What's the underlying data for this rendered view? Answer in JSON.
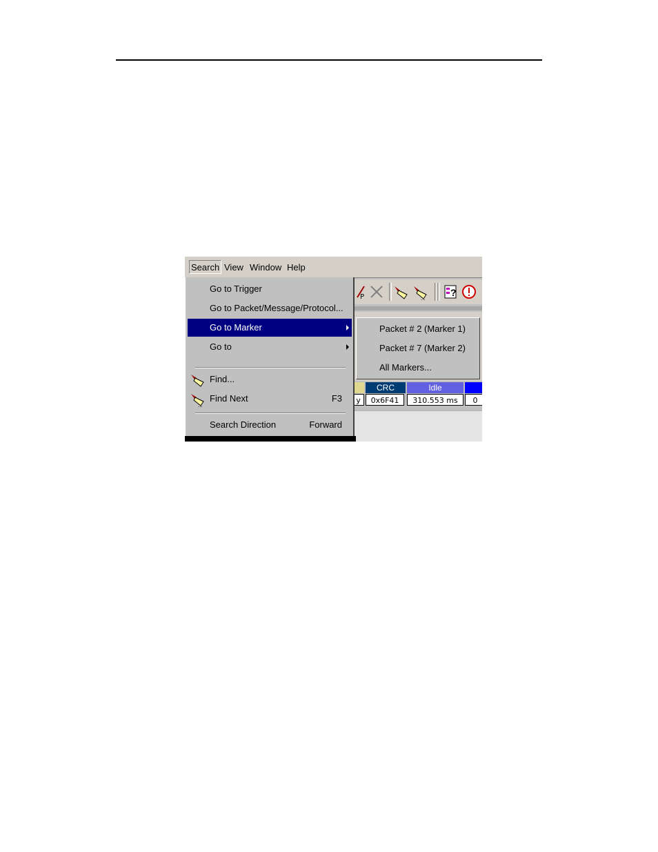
{
  "menubar": {
    "items": [
      {
        "label": "Search",
        "active": true
      },
      {
        "label": "View"
      },
      {
        "label": "Window"
      },
      {
        "label": "Help"
      }
    ]
  },
  "search_menu": {
    "items": [
      {
        "label": "Go to Trigger"
      },
      {
        "label": "Go to Packet/Message/Protocol..."
      },
      {
        "label": "Go to Marker",
        "highlighted": true,
        "submenu": true
      },
      {
        "label": "Go to",
        "submenu": true
      },
      {
        "label": "Find...",
        "icon": "flashlight-find-icon"
      },
      {
        "label": "Find Next",
        "shortcut": "F3",
        "icon": "flashlight-find-next-icon"
      },
      {
        "label": "Search Direction",
        "value": "Forward"
      }
    ]
  },
  "marker_submenu": {
    "items": [
      {
        "label": "Packet # 2 (Marker 1)"
      },
      {
        "label": "Packet # 7 (Marker 2)"
      },
      {
        "label": "All Markers..."
      }
    ]
  },
  "trace": {
    "headers": [
      {
        "label": "",
        "color": "#e0d890"
      },
      {
        "label": "CRC",
        "color": "#003c74"
      },
      {
        "label": "Idle",
        "color": "#6060e0"
      },
      {
        "label": "",
        "color": "#0000ff"
      }
    ],
    "values": [
      "y",
      "0x6F41",
      "310.553 ms",
      "0"
    ]
  },
  "colors": {
    "menu_highlight": "#000080",
    "menu_bg": "#c0c0c0"
  }
}
